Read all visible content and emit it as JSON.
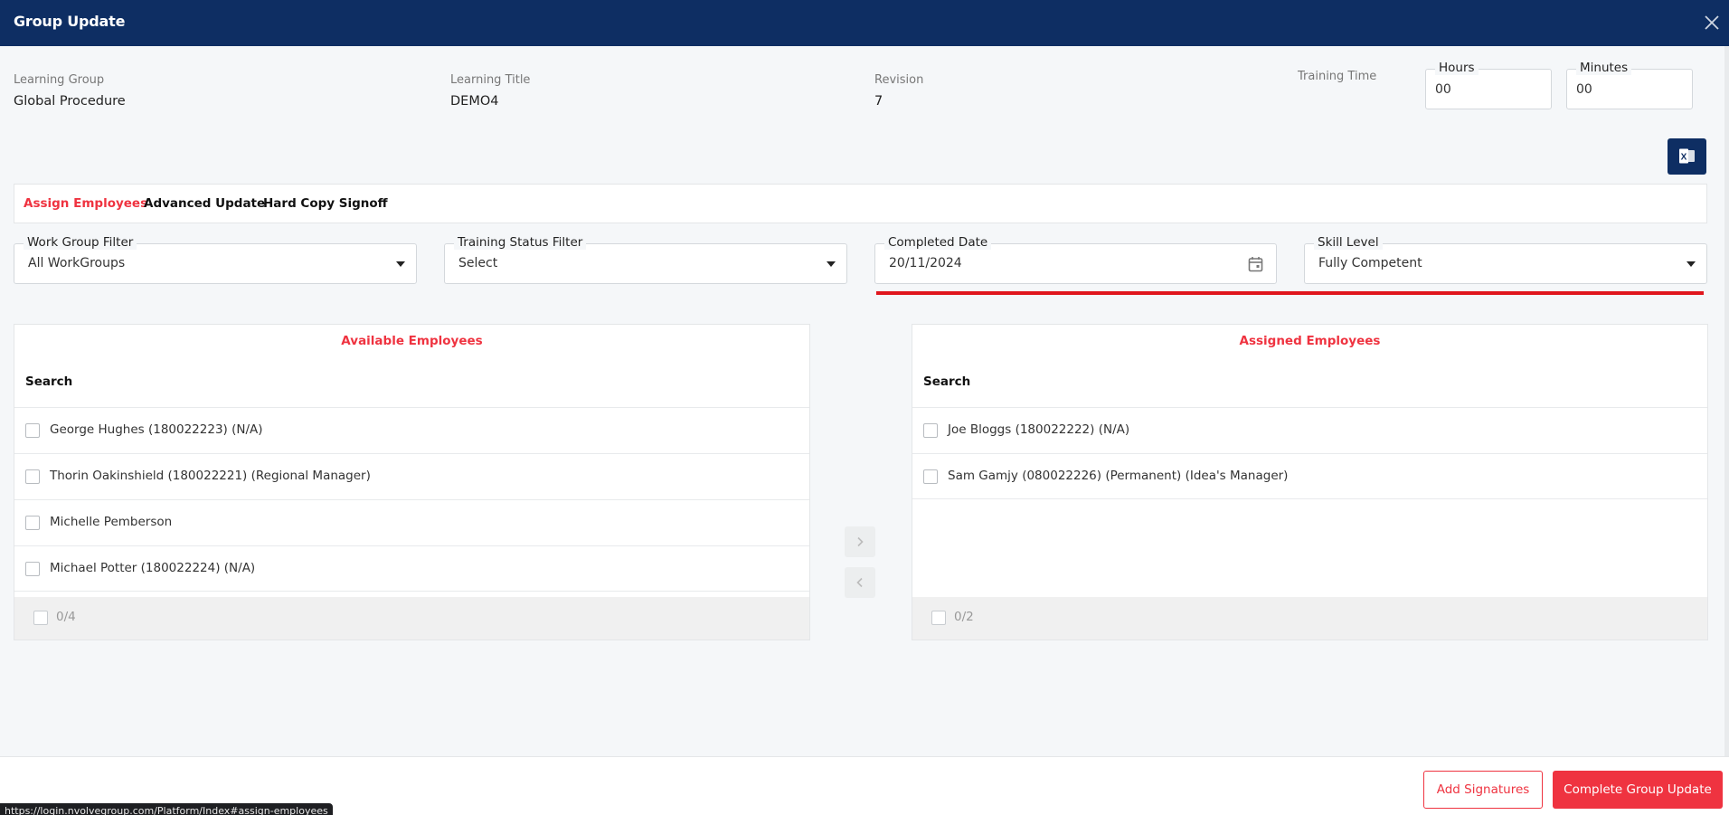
{
  "header": {
    "title": "Group Update",
    "close_icon": "close-icon"
  },
  "meta": {
    "learning_group_label": "Learning Group",
    "learning_group_value": "Global Procedure",
    "learning_title_label": "Learning Title",
    "learning_title_value": "DEMO4",
    "revision_label": "Revision",
    "revision_value": "7",
    "training_time_label": "Training Time",
    "hours_label": "Hours",
    "hours_value": "00",
    "minutes_label": "Minutes",
    "minutes_value": "00"
  },
  "export_icon": "excel-icon",
  "tabs": [
    {
      "label": "Assign Employees",
      "active": true
    },
    {
      "label": "Advanced Update",
      "active": false
    },
    {
      "label": "Hard Copy Signoff",
      "active": false
    }
  ],
  "filters": {
    "work_group": {
      "label": "Work Group Filter",
      "value": "All WorkGroups"
    },
    "training_status": {
      "label": "Training Status Filter",
      "value": "Select"
    },
    "completed_date": {
      "label": "Completed Date",
      "value": "20/11/2024"
    },
    "skill_level": {
      "label": "Skill Level",
      "value": "Fully Competent"
    }
  },
  "available": {
    "title": "Available Employees",
    "search_label": "Search",
    "items": [
      "George Hughes (180022223) (N/A)",
      "Thorin Oakinshield (180022221) (Regional Manager)",
      "Michelle Pemberson",
      "Michael Potter (180022224) (N/A)"
    ],
    "count": "0/4"
  },
  "assigned": {
    "title": "Assigned Employees",
    "search_label": "Search",
    "items": [
      "Joe Bloggs (180022222) (N/A)",
      "Sam Gamjy (080022226) (Permanent) (Idea's Manager)"
    ],
    "count": "0/2"
  },
  "actions": {
    "add_signatures": "Add Signatures",
    "complete": "Complete Group Update"
  },
  "status_url": "https://login.nvolvegroup.com/Platform/Index#assign-employees",
  "colors": {
    "header": "#0e2e63",
    "accent": "#ef3340"
  }
}
